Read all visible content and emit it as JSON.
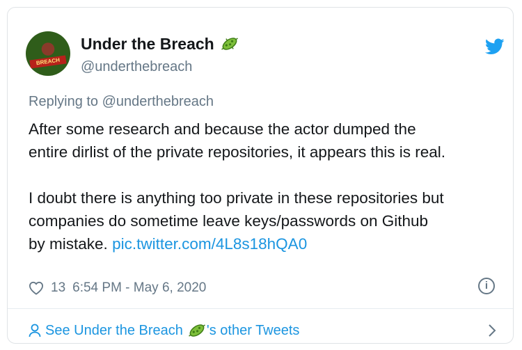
{
  "tweet": {
    "author_name": "Under the Breach",
    "author_handle": "@underthebreach",
    "avatar_text": "BREACH",
    "reply_prefix": "Replying to",
    "reply_handle": "@underthebreach",
    "text_line1": "After some research and because the actor dumped the",
    "text_line2": "entire dirlist of the private repositories, it appears this is real.",
    "text_line3": "I doubt there is anything too private in these repositories but",
    "text_line4": "companies do sometime leave keys/passwords on Github",
    "text_line5_prefix": "by mistake.",
    "link": "pic.twitter.com/4L8s18hQA0",
    "likes": "13",
    "timestamp": "6:54 PM - May 6, 2020"
  },
  "footer": {
    "prefix": "See Under the Breach",
    "suffix": "'s other Tweets"
  },
  "icons": {
    "twitter": "twitter-bird-icon",
    "virus": "virus-emoji-icon",
    "heart": "heart-icon",
    "info": "info-icon",
    "person": "person-icon",
    "chevron": "chevron-right-icon"
  },
  "colors": {
    "accent": "#1b95e0",
    "muted": "#657786",
    "text": "#14171a"
  }
}
